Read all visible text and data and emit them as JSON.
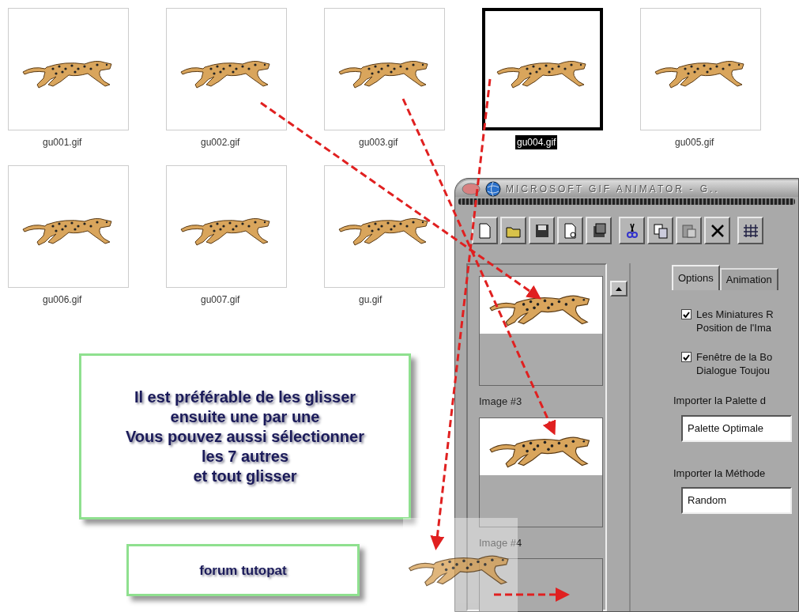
{
  "thumbnails": [
    {
      "filename": "gu001.gif",
      "selected": false
    },
    {
      "filename": "gu002.gif",
      "selected": false
    },
    {
      "filename": "gu003.gif",
      "selected": false
    },
    {
      "filename": "gu004.gif",
      "selected": true
    },
    {
      "filename": "gu005.gif",
      "selected": false
    },
    {
      "filename": "gu006.gif",
      "selected": false
    },
    {
      "filename": "gu007.gif",
      "selected": false
    },
    {
      "filename": "gu.gif",
      "selected": false
    }
  ],
  "callouts": [
    {
      "lines": [
        "Il est préférable de les glisser",
        "ensuite une par une",
        "Vous pouvez aussi sélectionner",
        "les 7 autres",
        "et tout glisser"
      ]
    },
    {
      "lines": [
        "forum tutopat"
      ]
    }
  ],
  "gif_animator": {
    "title": "MICROSOFT GIF ANIMATOR - G..",
    "frames": [
      {
        "kind": "cheetah",
        "label": "Image #3"
      },
      {
        "kind": "cheetah",
        "label": "Image #4"
      },
      {
        "kind": "empty"
      }
    ],
    "tabs": [
      {
        "label": "Options",
        "selected": true
      },
      {
        "label": "Animation",
        "selected": false
      }
    ],
    "checkboxes": [
      {
        "lines": [
          "Les Miniatures R",
          "Position de l'Ima"
        ],
        "checked": true
      },
      {
        "lines": [
          "Fenêtre de la Bo",
          "Dialogue Toujou"
        ],
        "checked": true
      }
    ],
    "dropdowns": [
      {
        "label": "Importer la Palette d",
        "value": "Palette Optimale"
      },
      {
        "label": "Importer la Méthode",
        "value": "Random"
      }
    ]
  }
}
